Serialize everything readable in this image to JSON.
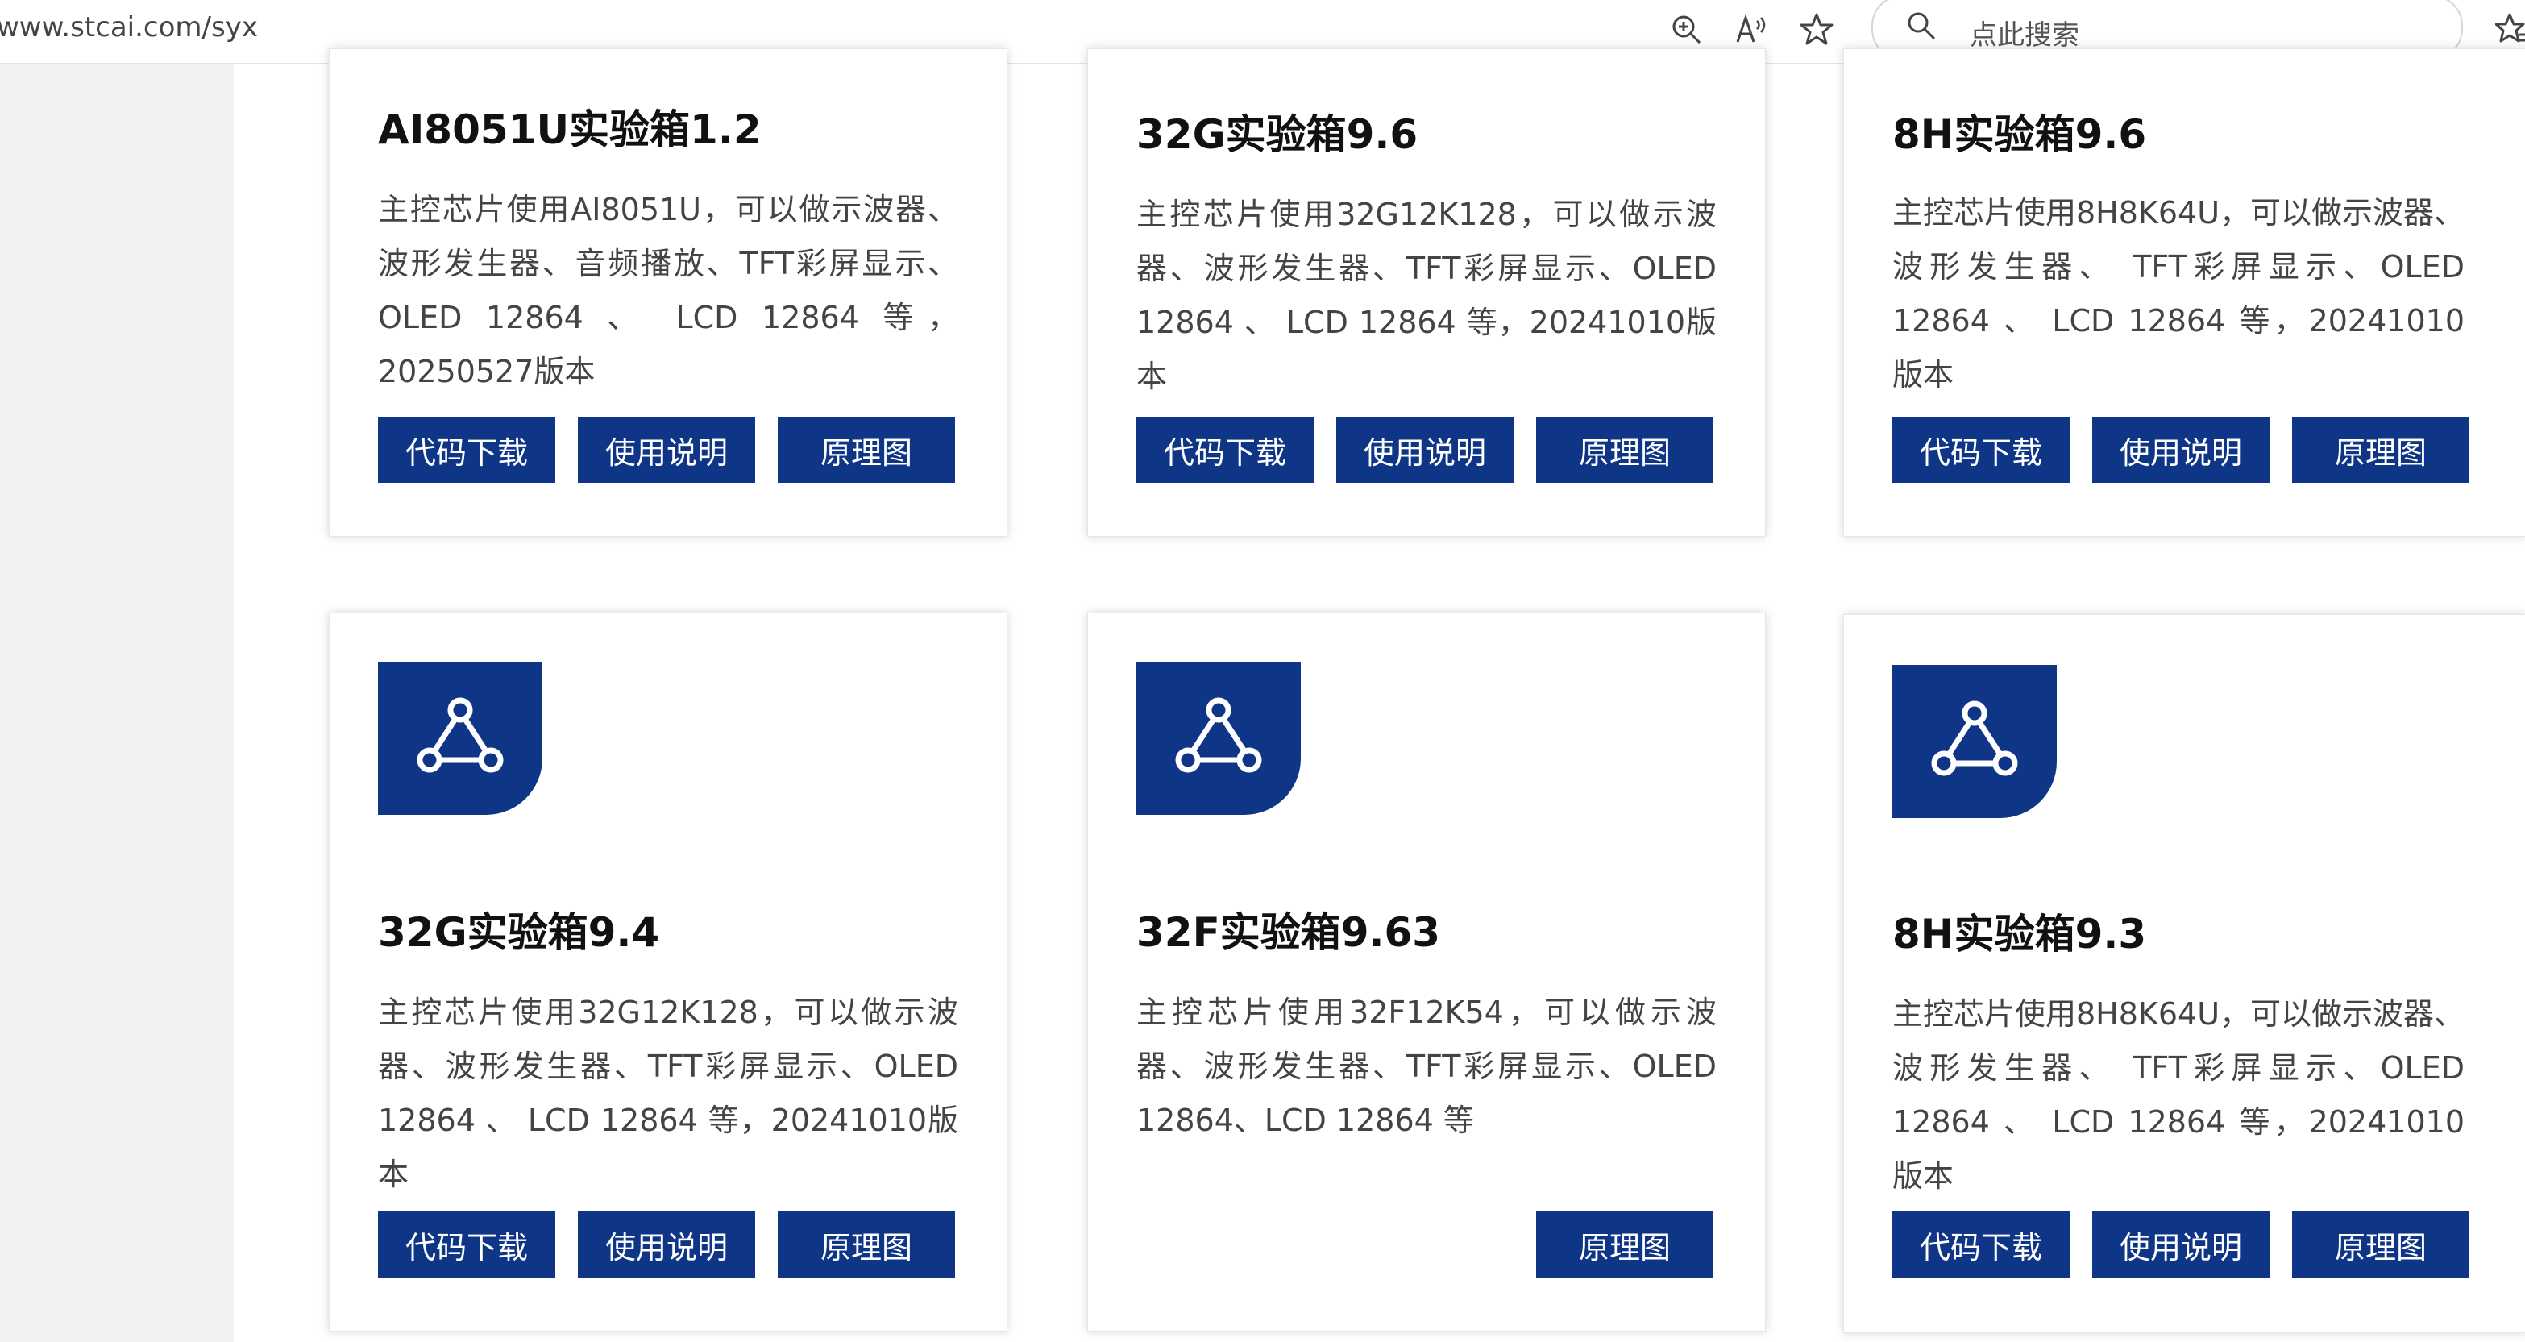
{
  "browser": {
    "url": "www.stcai.com/syx",
    "search_placeholder": "点此搜索"
  },
  "colors": {
    "accent": "#0f3586"
  },
  "cards": [
    {
      "title": "AI8051U实验箱1.2",
      "desc": "主控芯片使用AI8051U，可以做示波器、波形发生器、音频播放、TFT彩屏显示、OLED 12864 、 LCD 12864 等，20250527版本",
      "buttons": [
        "代码下载",
        "使用说明",
        "原理图"
      ]
    },
    {
      "title": "32G实验箱9.6",
      "desc": "主控芯片使用32G12K128，可以做示波器、波形发生器、TFT彩屏显示、OLED 12864 、 LCD 12864 等，20241010版本",
      "buttons": [
        "代码下载",
        "使用说明",
        "原理图"
      ]
    },
    {
      "title": "8H实验箱9.6",
      "desc": "主控芯片使用8H8K64U，可以做示波器、波形发生器、 TFT彩屏显示、OLED 12864 、 LCD 12864 等，20241010版本",
      "buttons": [
        "代码下载",
        "使用说明",
        "原理图"
      ]
    },
    {
      "title": "32G实验箱9.4",
      "desc": "主控芯片使用32G12K128，可以做示波器、波形发生器、TFT彩屏显示、OLED 12864 、 LCD 12864 等，20241010版本",
      "buttons": [
        "代码下载",
        "使用说明",
        "原理图"
      ]
    },
    {
      "title": "32F实验箱9.63",
      "desc": "主控芯片使用32F12K54，可以做示波器、波形发生器、TFT彩屏显示、OLED 12864、LCD 12864 等",
      "buttons": [
        "原理图"
      ]
    },
    {
      "title": "8H实验箱9.3",
      "desc": "主控芯片使用8H8K64U，可以做示波器、波形发生器、 TFT彩屏显示、OLED 12864 、 LCD 12864 等，20241010版本",
      "buttons": [
        "代码下载",
        "使用说明",
        "原理图"
      ]
    }
  ]
}
